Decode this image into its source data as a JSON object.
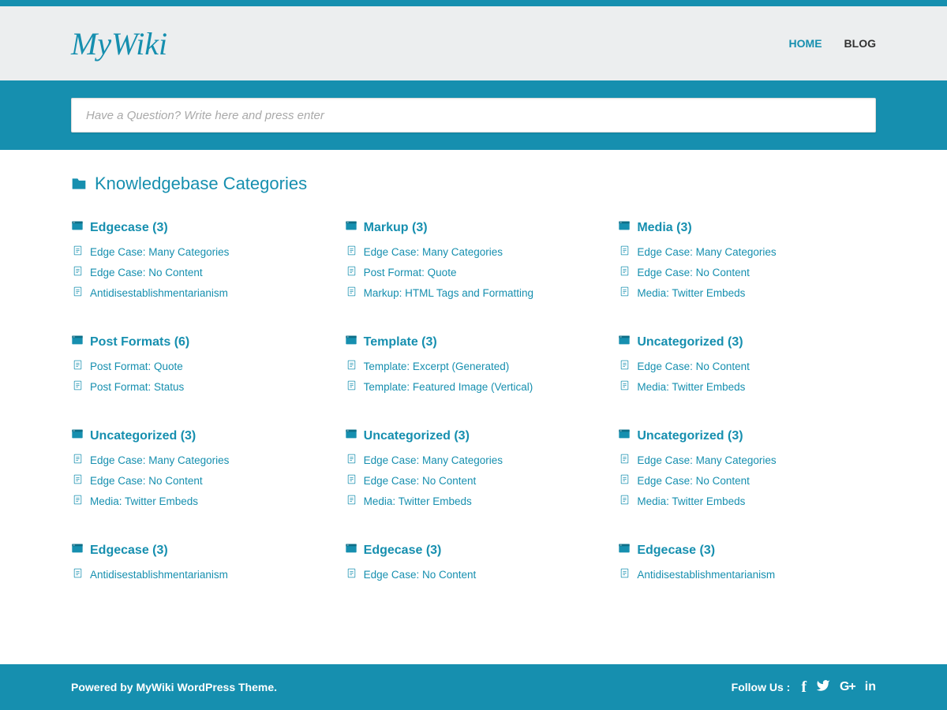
{
  "header": {
    "logo": "MyWiki",
    "nav": [
      {
        "label": "HOME",
        "active": true
      },
      {
        "label": "BLOG",
        "active": false
      }
    ]
  },
  "search": {
    "placeholder": "Have a Question? Write here and press enter"
  },
  "page": {
    "title": "Knowledgebase Categories"
  },
  "categories": [
    {
      "title": "Edgecase (3)",
      "articles": [
        "Edge Case: Many Categories",
        "Edge Case: No Content",
        "Antidisestablishmentarianism"
      ]
    },
    {
      "title": "Markup (3)",
      "articles": [
        "Edge Case: Many Categories",
        "Post Format: Quote",
        "Markup: HTML Tags and Formatting"
      ]
    },
    {
      "title": "Media (3)",
      "articles": [
        "Edge Case: Many Categories",
        "Edge Case: No Content",
        "Media: Twitter Embeds"
      ]
    },
    {
      "title": "Post Formats (6)",
      "articles": [
        "Post Format: Quote",
        "Post Format: Status"
      ]
    },
    {
      "title": "Template (3)",
      "articles": [
        "Template: Excerpt (Generated)",
        "Template: Featured Image (Vertical)"
      ]
    },
    {
      "title": "Uncategorized (3)",
      "articles": [
        "Edge Case: No Content",
        "Media: Twitter Embeds"
      ]
    },
    {
      "title": "Uncategorized (3)",
      "articles": [
        "Edge Case: Many Categories",
        "Edge Case: No Content",
        "Media: Twitter Embeds"
      ]
    },
    {
      "title": "Uncategorized (3)",
      "articles": [
        "Edge Case: Many Categories",
        "Edge Case: No Content",
        "Media: Twitter Embeds"
      ]
    },
    {
      "title": "Uncategorized (3)",
      "articles": [
        "Edge Case: Many Categories",
        "Edge Case: No Content",
        "Media: Twitter Embeds"
      ]
    },
    {
      "title": "Edgecase (3)",
      "articles": [
        "Antidisestablishmentarianism"
      ]
    },
    {
      "title": "Edgecase (3)",
      "articles": [
        "Edge Case: No Content"
      ]
    },
    {
      "title": "Edgecase (3)",
      "articles": [
        "Antidisestablishmentarianism"
      ]
    }
  ],
  "footer": {
    "credit": "Powered by MyWiki WordPress Theme.",
    "follow_label": "Follow Us :"
  }
}
